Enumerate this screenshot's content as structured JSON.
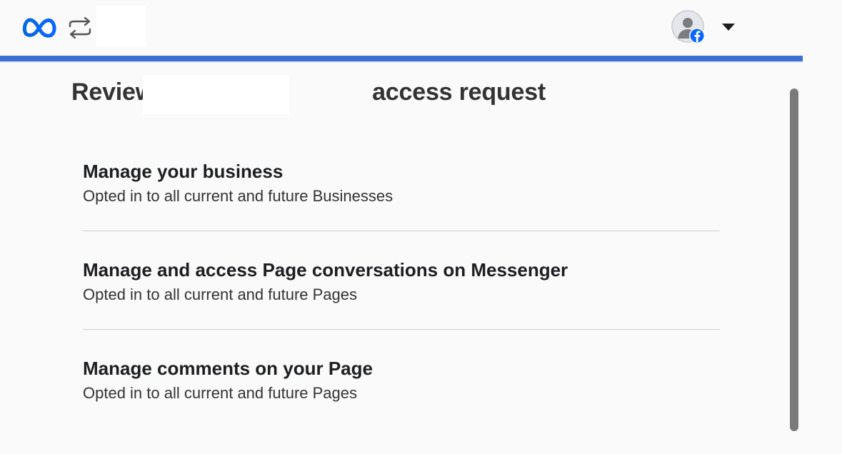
{
  "header": {
    "logo_icon": "meta-logo-icon",
    "switch_icon": "switch-accounts-icon",
    "avatar_icon": "profile-avatar-facebook-icon",
    "menu_icon": "caret-down-icon"
  },
  "progress": {
    "percent": 100,
    "color": "#3b6fd4"
  },
  "page": {
    "title": "Review                                 access request"
  },
  "permissions": [
    {
      "title": "Manage your business",
      "description": "Opted in to all current and future Businesses"
    },
    {
      "title": "Manage and access Page conversations on Messenger",
      "description": "Opted in to all current and future Pages"
    },
    {
      "title": "Manage comments on your Page",
      "description": "Opted in to all current and future Pages"
    }
  ],
  "colors": {
    "brand_blue": "#0866ff",
    "accent_line": "#3b6fd4",
    "scrollbar": "#7a7a7a"
  }
}
